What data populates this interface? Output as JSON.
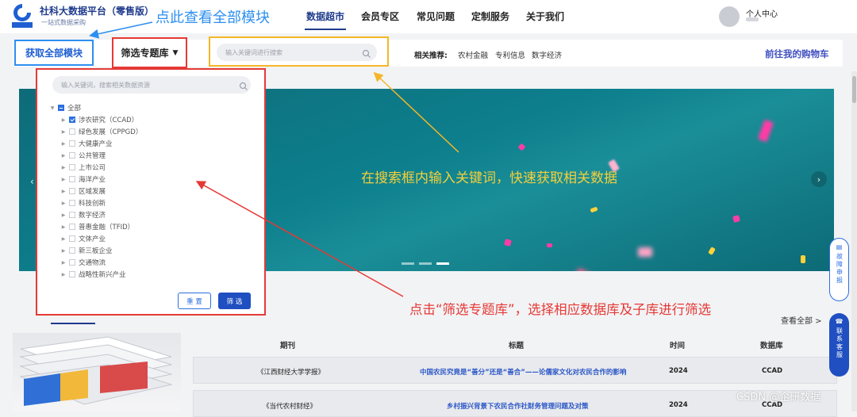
{
  "brand": {
    "title": "社科大数据平台（零售版）",
    "subtitle": "一站式数据采购"
  },
  "annotations": {
    "top": "点此查看全部模块",
    "search": "在搜索框内输入关键词，快速获取相关数据",
    "filter": "点击“筛选专题库”，选择相应数据库及子库进行筛选"
  },
  "nav": {
    "items": [
      "数据超市",
      "会员专区",
      "常见问题",
      "定制服务",
      "关于我们"
    ]
  },
  "user": {
    "label": "个人中心"
  },
  "toolbar": {
    "all_modules": "获取全部模块",
    "filter_label": "筛选专题库",
    "search_placeholder": "输入关键词进行搜索",
    "related_label": "相关推荐:",
    "related_items": [
      "农村金融",
      "专利信息",
      "数字经济"
    ],
    "cart": "前往我的购物车"
  },
  "panel": {
    "search_placeholder": "输入关键词，搜索相关数据资源",
    "root": "全部",
    "items": [
      {
        "label": "涉农研究（CCAD）",
        "checked": true
      },
      {
        "label": "绿色发展（CPPGD）",
        "checked": false
      },
      {
        "label": "大健康产业",
        "checked": false
      },
      {
        "label": "公共管理",
        "checked": false
      },
      {
        "label": "上市公司",
        "checked": false
      },
      {
        "label": "海洋产业",
        "checked": false
      },
      {
        "label": "区域发展",
        "checked": false
      },
      {
        "label": "科技创新",
        "checked": false
      },
      {
        "label": "数字经济",
        "checked": false
      },
      {
        "label": "普惠金融（TFID）",
        "checked": false
      },
      {
        "label": "文体产业",
        "checked": false
      },
      {
        "label": "新三板企业",
        "checked": false
      },
      {
        "label": "交通物流",
        "checked": false
      },
      {
        "label": "战略性新兴产业",
        "checked": false
      }
    ],
    "reset": "重 置",
    "confirm": "筛 选"
  },
  "section": {
    "view_all": "查看全部 >"
  },
  "table": {
    "headers": [
      "期刊",
      "标题",
      "时间",
      "数据库"
    ],
    "rows": [
      {
        "journal": "《江西财经大学学报》",
        "title": "中国农民究竟是“善分”还是“善合”——论儒家文化对农民合作的影响",
        "year": "2024",
        "db": "CCAD"
      },
      {
        "journal": "《当代农村财经》",
        "title": "乡村振兴背景下农民合作社财务管理问题及对策",
        "year": "2024",
        "db": "CCAD"
      }
    ]
  },
  "side_buttons": {
    "fault": "故障申报",
    "contact": "联系客服"
  },
  "watermark": "CSDN @企研数据"
}
